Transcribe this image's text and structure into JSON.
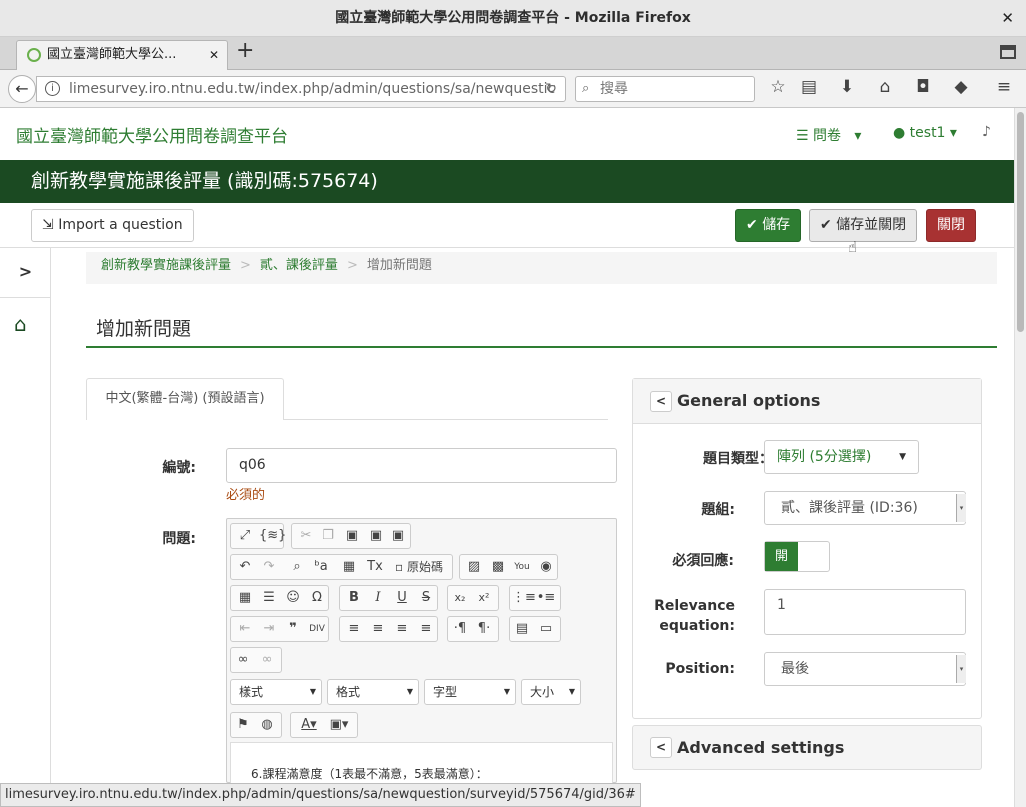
{
  "window": {
    "title": "國立臺灣師範大學公用問卷調查平台 - Mozilla Firefox",
    "close_glyph": "✕"
  },
  "tabbar": {
    "tab_title": "國立臺灣師範大學公...",
    "tab_close": "✕",
    "new_tab": "+"
  },
  "navbar": {
    "url": "limesurvey.iro.ntnu.edu.tw/index.php/admin/questions/sa/newquestic",
    "search_placeholder": "搜尋"
  },
  "site": {
    "title": "國立臺灣師範大學公用問卷調查平台",
    "menu_surveys": "問卷",
    "menu_user": "test1"
  },
  "survey": {
    "title": "創新教學實施課後評量 (識別碼:575674)"
  },
  "toolbar": {
    "import_label": "Import a question",
    "save_label": "儲存",
    "save_close_label": "儲存並關閉",
    "close_label": "關閉"
  },
  "breadcrumb": {
    "survey": "創新教學實施課後評量",
    "group": "貳、課後評量",
    "current": "增加新問題",
    "separator": ">"
  },
  "page": {
    "title": "增加新問題",
    "language_tab": "中文(繁體-台灣) (預設語言)"
  },
  "form": {
    "code_label": "編號:",
    "code_value": "q06",
    "required_text": "必須的",
    "question_label": "問題:",
    "editor": {
      "source_label": "原始碼",
      "combo_styles": "樣式",
      "combo_format": "格式",
      "combo_font": "字型",
      "combo_size": "大小",
      "content": "6.課程滿意度（1表最不滿意，5表最滿意）："
    }
  },
  "general": {
    "header": "General options",
    "type_label": "題目類型：",
    "type_value": "陣列 (5分選擇)",
    "group_label": "題組:",
    "group_value": "貳、課後評量 (ID:36)",
    "mandatory_label": "必須回應:",
    "mandatory_on": "開",
    "relevance_label": "Relevance equation:",
    "relevance_value": "1",
    "position_label": "Position:",
    "position_value": "最後"
  },
  "advanced": {
    "header": "Advanced settings"
  },
  "status": {
    "url": "limesurvey.iro.ntnu.edu.tw/index.php/admin/questions/sa/newquestion/surveyid/575674/gid/36#"
  },
  "colors": {
    "brand_green": "#2e7d32",
    "survey_bar": "#1b4a22",
    "danger": "#a83232"
  }
}
